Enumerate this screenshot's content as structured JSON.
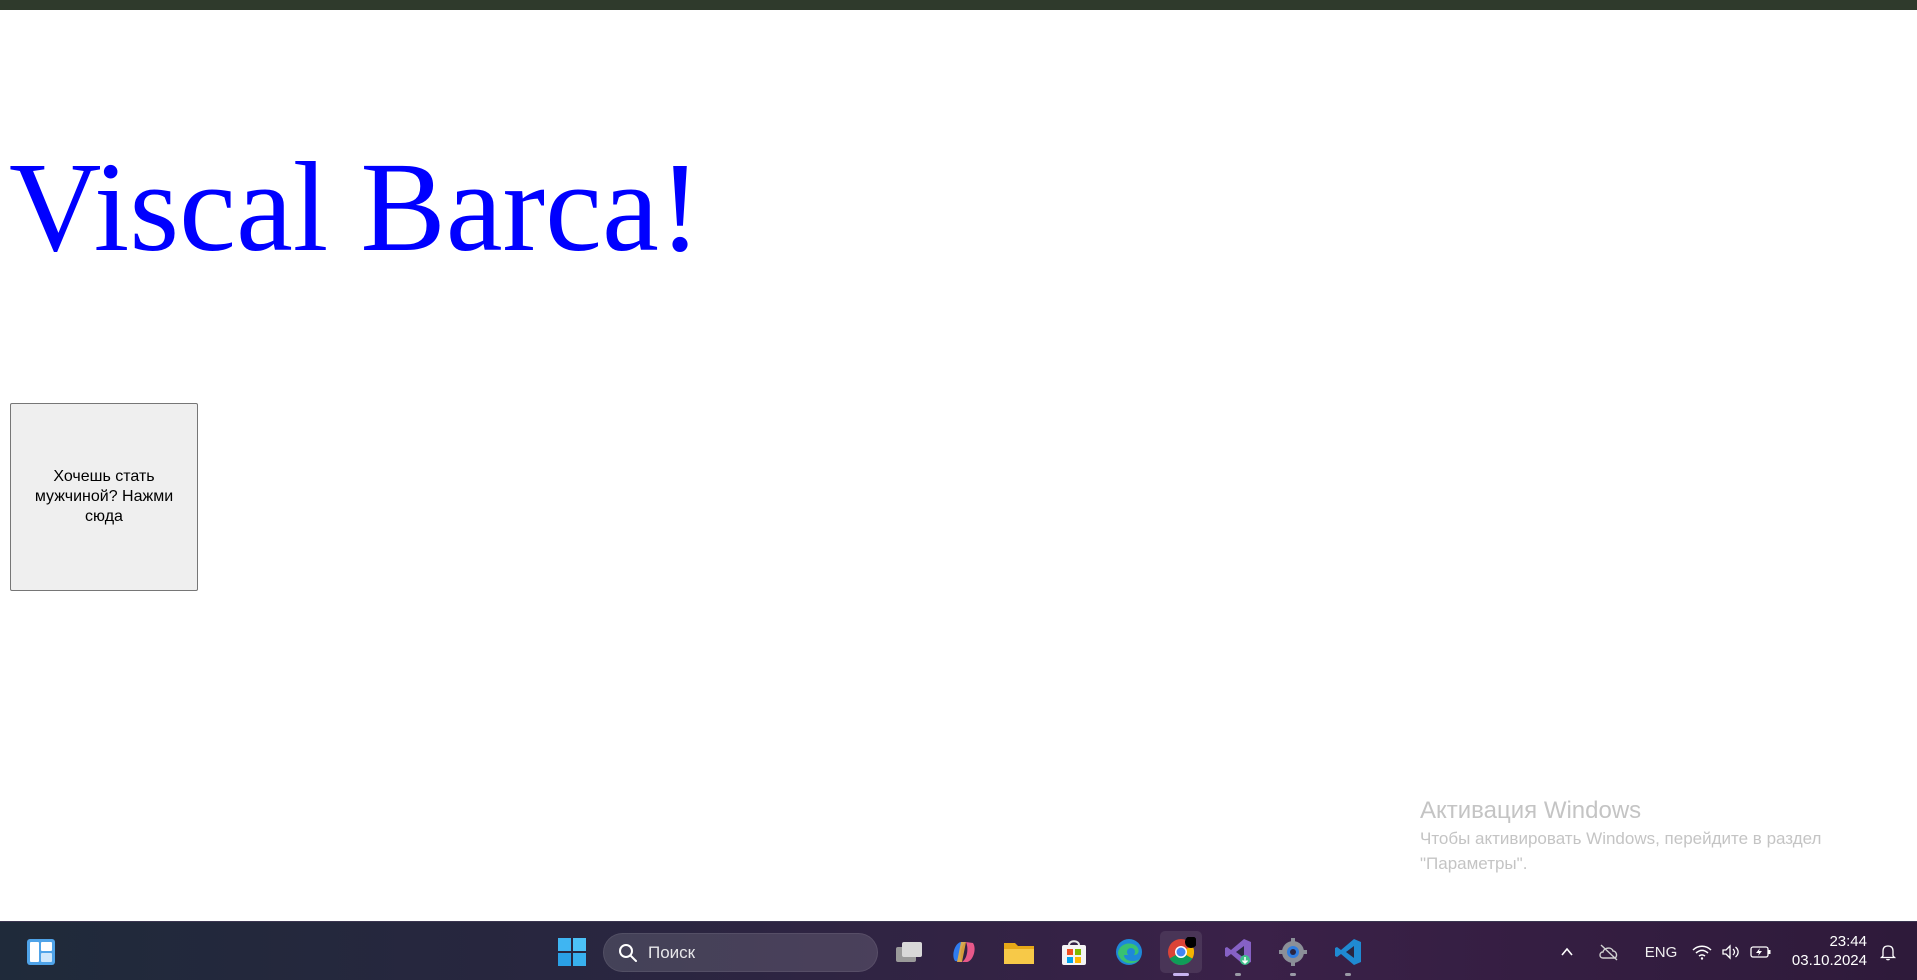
{
  "page": {
    "heading": "Viscal Barca!",
    "button_label": "Хочешь стать мужчиной? Нажми сюда"
  },
  "watermark": {
    "title": "Активация Windows",
    "line1": "Чтобы активировать Windows, перейдите в раздел",
    "line2": "\"Параметры\"."
  },
  "taskbar": {
    "search_placeholder": "Поиск",
    "apps": [
      {
        "name": "task-view-icon"
      },
      {
        "name": "copilot-icon"
      },
      {
        "name": "file-explorer-icon"
      },
      {
        "name": "microsoft-store-icon"
      },
      {
        "name": "edge-icon"
      },
      {
        "name": "chrome-icon",
        "active": true
      },
      {
        "name": "visual-studio-icon"
      },
      {
        "name": "settings-icon"
      },
      {
        "name": "vscode-icon"
      }
    ],
    "language": "ENG",
    "time": "23:44",
    "date": "03.10.2024"
  },
  "colors": {
    "heading": "#0000ff",
    "button_bg": "#efefef",
    "taskbar_start": "#1f2a3a",
    "taskbar_end": "#3a2148"
  }
}
